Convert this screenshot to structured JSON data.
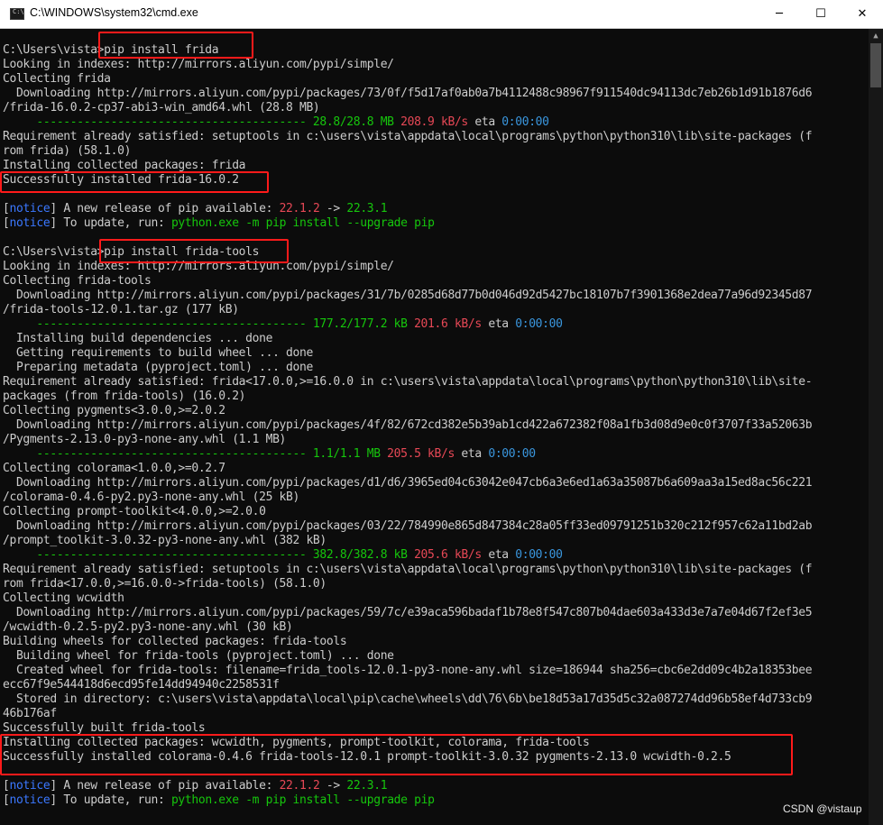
{
  "window": {
    "title": "C:\\WINDOWS\\system32\\cmd.exe",
    "icon_label": "C:\\",
    "minimize_glyph": "─",
    "maximize_glyph": "☐",
    "close_glyph": "✕"
  },
  "scrollbar": {
    "up_glyph": "▲"
  },
  "colors": {
    "background": "#0c0c0c",
    "default_text": "#cccccc",
    "notice_blue": "#3b78ff",
    "red": "#e74856",
    "green": "#16c60c",
    "cyan": "#3a96dd",
    "highlight_box": "#ff1a1a"
  },
  "console_lines": [
    [
      {
        "t": "",
        "c": ""
      }
    ],
    [
      {
        "t": "C:\\Users\\vista>pip install frida",
        "c": ""
      }
    ],
    [
      {
        "t": "Looking in indexes: http://mirrors.aliyun.com/pypi/simple/",
        "c": ""
      }
    ],
    [
      {
        "t": "Collecting frida",
        "c": ""
      }
    ],
    [
      {
        "t": "  Downloading http://mirrors.aliyun.com/pypi/packages/73/0f/f5d17af0ab0a7b4112488c98967f911540dc94113dc7eb26b1d91b1876d6",
        "c": ""
      }
    ],
    [
      {
        "t": "/frida-16.0.2-cp37-abi3-win_amd64.whl (28.8 MB)",
        "c": ""
      }
    ],
    [
      {
        "t": "     ---------------------------------------- 28.8/28.8 MB ",
        "c": "g"
      },
      {
        "t": "208.9 kB/s",
        "c": "r"
      },
      {
        "t": " eta ",
        "c": ""
      },
      {
        "t": "0:00:00",
        "c": "c"
      }
    ],
    [
      {
        "t": "Requirement already satisfied: setuptools in c:\\users\\vista\\appdata\\local\\programs\\python\\python310\\lib\\site-packages (f",
        "c": ""
      }
    ],
    [
      {
        "t": "rom frida) (58.1.0)",
        "c": ""
      }
    ],
    [
      {
        "t": "Installing collected packages: frida",
        "c": ""
      }
    ],
    [
      {
        "t": "Successfully installed frida-16.0.2",
        "c": ""
      }
    ],
    [
      {
        "t": "",
        "c": ""
      }
    ],
    [
      {
        "t": "[",
        "c": ""
      },
      {
        "t": "notice",
        "c": "b"
      },
      {
        "t": "] A new release of pip available: ",
        "c": ""
      },
      {
        "t": "22.1.2",
        "c": "r"
      },
      {
        "t": " -> ",
        "c": ""
      },
      {
        "t": "22.3.1",
        "c": "g"
      }
    ],
    [
      {
        "t": "[",
        "c": ""
      },
      {
        "t": "notice",
        "c": "b"
      },
      {
        "t": "] To update, run: ",
        "c": ""
      },
      {
        "t": "python.exe -m pip install --upgrade pip",
        "c": "g"
      }
    ],
    [
      {
        "t": "",
        "c": ""
      }
    ],
    [
      {
        "t": "C:\\Users\\vista>pip install frida-tools",
        "c": ""
      }
    ],
    [
      {
        "t": "Looking in indexes: http://mirrors.aliyun.com/pypi/simple/",
        "c": ""
      }
    ],
    [
      {
        "t": "Collecting frida-tools",
        "c": ""
      }
    ],
    [
      {
        "t": "  Downloading http://mirrors.aliyun.com/pypi/packages/31/7b/0285d68d77b0d046d92d5427bc18107b7f3901368e2dea77a96d92345d87",
        "c": ""
      }
    ],
    [
      {
        "t": "/frida-tools-12.0.1.tar.gz (177 kB)",
        "c": ""
      }
    ],
    [
      {
        "t": "     ---------------------------------------- 177.2/177.2 kB ",
        "c": "g"
      },
      {
        "t": "201.6 kB/s",
        "c": "r"
      },
      {
        "t": " eta ",
        "c": ""
      },
      {
        "t": "0:00:00",
        "c": "c"
      }
    ],
    [
      {
        "t": "  Installing build dependencies ... done",
        "c": ""
      }
    ],
    [
      {
        "t": "  Getting requirements to build wheel ... done",
        "c": ""
      }
    ],
    [
      {
        "t": "  Preparing metadata (pyproject.toml) ... done",
        "c": ""
      }
    ],
    [
      {
        "t": "Requirement already satisfied: frida<17.0.0,>=16.0.0 in c:\\users\\vista\\appdata\\local\\programs\\python\\python310\\lib\\site-",
        "c": ""
      }
    ],
    [
      {
        "t": "packages (from frida-tools) (16.0.2)",
        "c": ""
      }
    ],
    [
      {
        "t": "Collecting pygments<3.0.0,>=2.0.2",
        "c": ""
      }
    ],
    [
      {
        "t": "  Downloading http://mirrors.aliyun.com/pypi/packages/4f/82/672cd382e5b39ab1cd422a672382f08a1fb3d08d9e0c0f3707f33a52063b",
        "c": ""
      }
    ],
    [
      {
        "t": "/Pygments-2.13.0-py3-none-any.whl (1.1 MB)",
        "c": ""
      }
    ],
    [
      {
        "t": "     ---------------------------------------- 1.1/1.1 MB ",
        "c": "g"
      },
      {
        "t": "205.5 kB/s",
        "c": "r"
      },
      {
        "t": " eta ",
        "c": ""
      },
      {
        "t": "0:00:00",
        "c": "c"
      }
    ],
    [
      {
        "t": "Collecting colorama<1.0.0,>=0.2.7",
        "c": ""
      }
    ],
    [
      {
        "t": "  Downloading http://mirrors.aliyun.com/pypi/packages/d1/d6/3965ed04c63042e047cb6a3e6ed1a63a35087b6a609aa3a15ed8ac56c221",
        "c": ""
      }
    ],
    [
      {
        "t": "/colorama-0.4.6-py2.py3-none-any.whl (25 kB)",
        "c": ""
      }
    ],
    [
      {
        "t": "Collecting prompt-toolkit<4.0.0,>=2.0.0",
        "c": ""
      }
    ],
    [
      {
        "t": "  Downloading http://mirrors.aliyun.com/pypi/packages/03/22/784990e865d847384c28a05ff33ed09791251b320c212f957c62a11bd2ab",
        "c": ""
      }
    ],
    [
      {
        "t": "/prompt_toolkit-3.0.32-py3-none-any.whl (382 kB)",
        "c": ""
      }
    ],
    [
      {
        "t": "     ---------------------------------------- 382.8/382.8 kB ",
        "c": "g"
      },
      {
        "t": "205.6 kB/s",
        "c": "r"
      },
      {
        "t": " eta ",
        "c": ""
      },
      {
        "t": "0:00:00",
        "c": "c"
      }
    ],
    [
      {
        "t": "Requirement already satisfied: setuptools in c:\\users\\vista\\appdata\\local\\programs\\python\\python310\\lib\\site-packages (f",
        "c": ""
      }
    ],
    [
      {
        "t": "rom frida<17.0.0,>=16.0.0->frida-tools) (58.1.0)",
        "c": ""
      }
    ],
    [
      {
        "t": "Collecting wcwidth",
        "c": ""
      }
    ],
    [
      {
        "t": "  Downloading http://mirrors.aliyun.com/pypi/packages/59/7c/e39aca596badaf1b78e8f547c807b04dae603a433d3e7a7e04d67f2ef3e5",
        "c": ""
      }
    ],
    [
      {
        "t": "/wcwidth-0.2.5-py2.py3-none-any.whl (30 kB)",
        "c": ""
      }
    ],
    [
      {
        "t": "Building wheels for collected packages: frida-tools",
        "c": ""
      }
    ],
    [
      {
        "t": "  Building wheel for frida-tools (pyproject.toml) ... done",
        "c": ""
      }
    ],
    [
      {
        "t": "  Created wheel for frida-tools: filename=frida_tools-12.0.1-py3-none-any.whl size=186944 sha256=cbc6e2dd09c4b2a18353bee",
        "c": ""
      }
    ],
    [
      {
        "t": "ecc67f9e544418d6ecd95fe14dd94940c2258531f",
        "c": ""
      }
    ],
    [
      {
        "t": "  Stored in directory: c:\\users\\vista\\appdata\\local\\pip\\cache\\wheels\\dd\\76\\6b\\be18d53a17d35d5c32a087274dd96b58ef4d733cb9",
        "c": ""
      }
    ],
    [
      {
        "t": "46b176af",
        "c": ""
      }
    ],
    [
      {
        "t": "Successfully built frida-tools",
        "c": ""
      }
    ],
    [
      {
        "t": "Installing collected packages: wcwidth, pygments, prompt-toolkit, colorama, frida-tools",
        "c": ""
      }
    ],
    [
      {
        "t": "Successfully installed colorama-0.4.6 frida-tools-12.0.1 prompt-toolkit-3.0.32 pygments-2.13.0 wcwidth-0.2.5",
        "c": ""
      }
    ],
    [
      {
        "t": "",
        "c": ""
      }
    ],
    [
      {
        "t": "[",
        "c": ""
      },
      {
        "t": "notice",
        "c": "b"
      },
      {
        "t": "] A new release of pip available: ",
        "c": ""
      },
      {
        "t": "22.1.2",
        "c": "r"
      },
      {
        "t": " -> ",
        "c": ""
      },
      {
        "t": "22.3.1",
        "c": "g"
      }
    ],
    [
      {
        "t": "[",
        "c": ""
      },
      {
        "t": "notice",
        "c": "b"
      },
      {
        "t": "] To update, run: ",
        "c": ""
      },
      {
        "t": "python.exe -m pip install --upgrade pip",
        "c": "g"
      }
    ],
    [
      {
        "t": "",
        "c": ""
      }
    ]
  ],
  "watermark": "CSDN @vistaup"
}
